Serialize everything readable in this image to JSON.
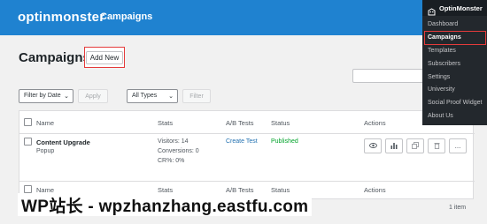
{
  "header": {
    "logo_text": "optinmonster",
    "title": "Campaigns"
  },
  "page": {
    "title": "Campaigns",
    "add_new_label": "Add New"
  },
  "filters": {
    "date_select": "Filter by Date",
    "apply_label": "Apply",
    "type_select": "All Types",
    "filter_label": "Filter"
  },
  "table": {
    "columns": [
      "Name",
      "Stats",
      "A/B Tests",
      "Status",
      "Actions"
    ],
    "rows": [
      {
        "name": "Content Upgrade",
        "type": "Popup",
        "visitors": "Visitors: 14",
        "conversions": "Conversions: 0",
        "cr": "CR%: 0%",
        "ab_test": "Create Test",
        "status": "Published"
      }
    ],
    "footer_columns": [
      "Name",
      "Stats",
      "A/B Tests",
      "Status",
      "Actions"
    ],
    "item_count": "1 item"
  },
  "actions": [
    {
      "icon": "eye-icon"
    },
    {
      "icon": "bar-chart-icon"
    },
    {
      "icon": "duplicate-icon"
    },
    {
      "icon": "trash-icon"
    },
    {
      "icon": "more-icon",
      "label": "..."
    }
  ],
  "menu": {
    "header": "OptinMonster",
    "items": [
      "Dashboard",
      "Campaigns",
      "Templates",
      "Subscribers",
      "Settings",
      "University",
      "Social Proof Widget",
      "About Us"
    ],
    "active": "Campaigns"
  },
  "watermark": "WP站长 - wpzhanzhang.eastfu.com",
  "colors": {
    "header_bg": "#1f82d0",
    "menu_bg": "#23282d",
    "highlight": "#e43b3b",
    "link": "#2271b1",
    "published": "#00a32a"
  }
}
